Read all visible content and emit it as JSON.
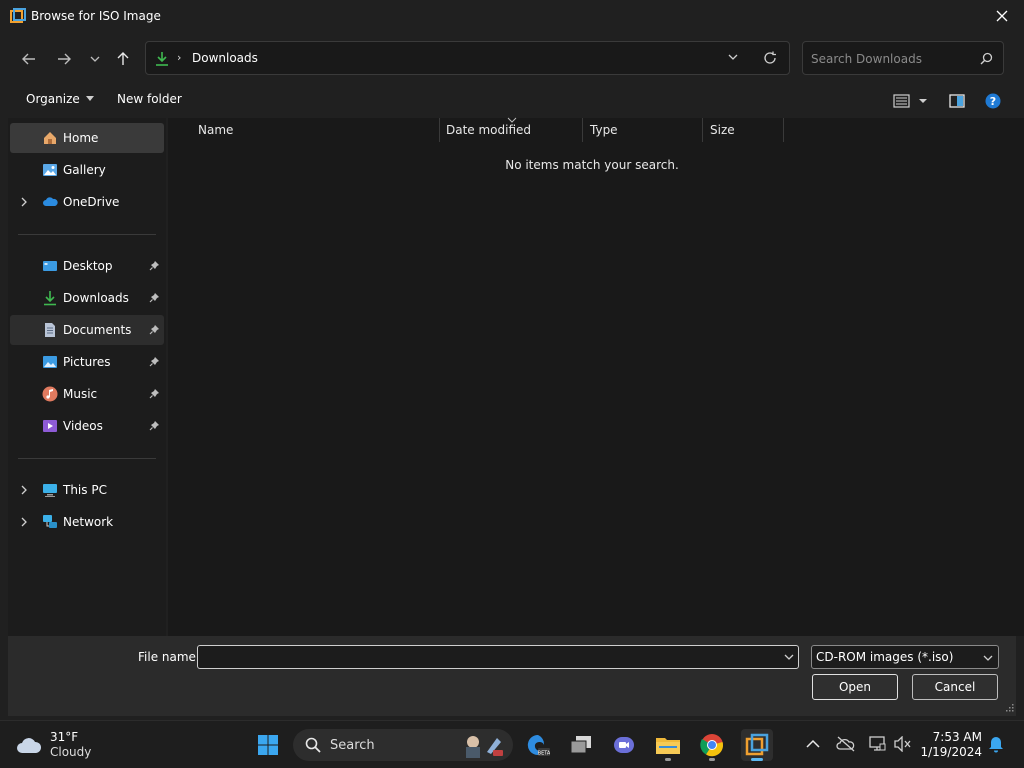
{
  "window": {
    "title": "Browse for ISO Image"
  },
  "address": {
    "current_folder": "Downloads",
    "search_placeholder": "Search Downloads"
  },
  "toolbar": {
    "organize_label": "Organize",
    "new_folder_label": "New folder"
  },
  "sidebar": {
    "items": [
      {
        "label": "Home",
        "icon": "home-icon",
        "expandable": false,
        "pinned": false
      },
      {
        "label": "Gallery",
        "icon": "gallery-icon",
        "expandable": false,
        "pinned": false
      },
      {
        "label": "OneDrive",
        "icon": "onedrive-icon",
        "expandable": true,
        "pinned": false
      },
      {
        "label": "Desktop",
        "icon": "desktop-icon",
        "expandable": false,
        "pinned": true
      },
      {
        "label": "Downloads",
        "icon": "downloads-icon",
        "expandable": false,
        "pinned": true
      },
      {
        "label": "Documents",
        "icon": "documents-icon",
        "expandable": false,
        "pinned": true
      },
      {
        "label": "Pictures",
        "icon": "pictures-icon",
        "expandable": false,
        "pinned": true
      },
      {
        "label": "Music",
        "icon": "music-icon",
        "expandable": false,
        "pinned": true
      },
      {
        "label": "Videos",
        "icon": "videos-icon",
        "expandable": false,
        "pinned": true
      },
      {
        "label": "This PC",
        "icon": "this-pc-icon",
        "expandable": true,
        "pinned": false
      },
      {
        "label": "Network",
        "icon": "network-icon",
        "expandable": true,
        "pinned": false
      }
    ]
  },
  "file_list": {
    "columns": [
      "Name",
      "Date modified",
      "Type",
      "Size"
    ],
    "empty_message": "No items match your search."
  },
  "footer": {
    "file_name_label": "File name:",
    "file_name_value": "",
    "file_type_filter": "CD-ROM images (*.iso)",
    "open_label": "Open",
    "cancel_label": "Cancel"
  },
  "taskbar": {
    "weather_temp": "31°F",
    "weather_condition": "Cloudy",
    "search_label": "Search",
    "time": "7:53 AM",
    "date": "1/19/2024"
  },
  "colors": {
    "accent": "#0078d4",
    "folder_yellow": "#f0b93a",
    "download_green": "#3fb950"
  }
}
